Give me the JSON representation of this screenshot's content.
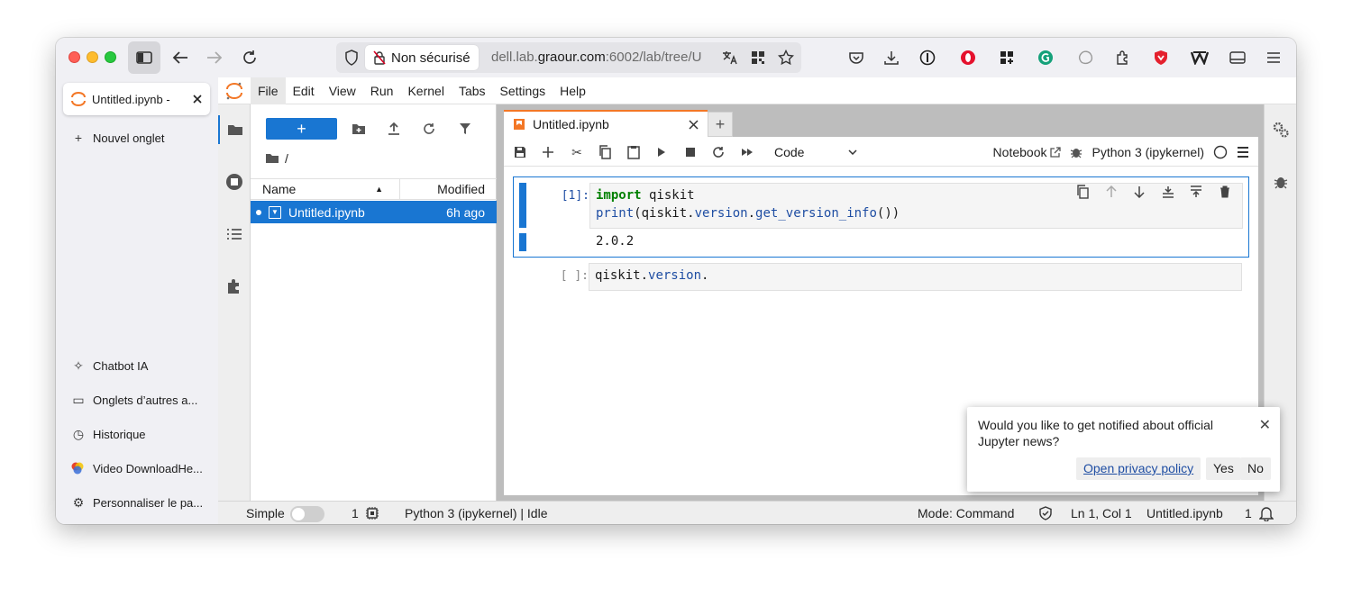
{
  "browser": {
    "security_label": "Non sécurisé",
    "url_host": "dell.lab.",
    "url_domain": "graour.com",
    "url_path": ":6002/lab/tree/U",
    "icons": [
      "shield-icon",
      "lock-slash-icon",
      "translate-icon",
      "qr-icon",
      "star-icon",
      "pocket-icon",
      "download-icon",
      "password-icon",
      "opera-icon",
      "grid-icon",
      "grammarly-icon",
      "extension-icon",
      "puzzle-icon",
      "vpn-icon",
      "w-icon",
      "sidebar-icon",
      "menu-icon"
    ]
  },
  "ff_sidebar": {
    "tab_title": "Untitled.ipynb - ",
    "new_tab": "Nouvel onglet",
    "items": [
      {
        "label": "Chatbot IA",
        "icon": "sparkle-icon"
      },
      {
        "label": "Onglets d’autres a...",
        "icon": "devices-icon"
      },
      {
        "label": "Historique",
        "icon": "clock-icon"
      },
      {
        "label": "Video DownloadHe...",
        "icon": "video-downloader-icon"
      },
      {
        "label": "Personnaliser le pa...",
        "icon": "settings-icon"
      }
    ]
  },
  "menubar": [
    "File",
    "Edit",
    "View",
    "Run",
    "Kernel",
    "Tabs",
    "Settings",
    "Help"
  ],
  "filebrowser": {
    "new_label": "+",
    "breadcrumb": "/",
    "col_name": "Name",
    "col_modified": "Modified",
    "files": [
      {
        "name": "Untitled.ipynb",
        "modified": "6h ago"
      }
    ]
  },
  "notebook": {
    "tab_title": "Untitled.ipynb",
    "add_tab": "+",
    "cell_type": "Code",
    "notebook_label": "Notebook",
    "kernel_name": "Python 3 (ipykernel)",
    "cells": [
      {
        "prompt": "[1]:",
        "line1_kw": "import",
        "line1_rest": " qiskit",
        "line2_fn": "print",
        "line2_a": "(qiskit.",
        "line2_b": "version",
        "line2_c": ".",
        "line2_d": "get_version_info",
        "line2_e": "())",
        "output": "2.0.2"
      },
      {
        "prompt": "[ ]:",
        "code_a": "qiskit.",
        "code_b": "version",
        "code_c": "."
      }
    ]
  },
  "statusbar": {
    "simple": "Simple",
    "terminals": "1",
    "kernel_status": "Python 3 (ipykernel) | Idle",
    "mode": "Mode: Command",
    "position": "Ln 1, Col 1",
    "filename": "Untitled.ipynb",
    "notifications": "1"
  },
  "toast": {
    "message": "Would you like to get notified about official Jupyter news?",
    "privacy": "Open privacy policy",
    "yes": "Yes",
    "no": "No"
  },
  "colors": {
    "accent": "#1976d2",
    "jupyter_orange": "#f37726"
  }
}
